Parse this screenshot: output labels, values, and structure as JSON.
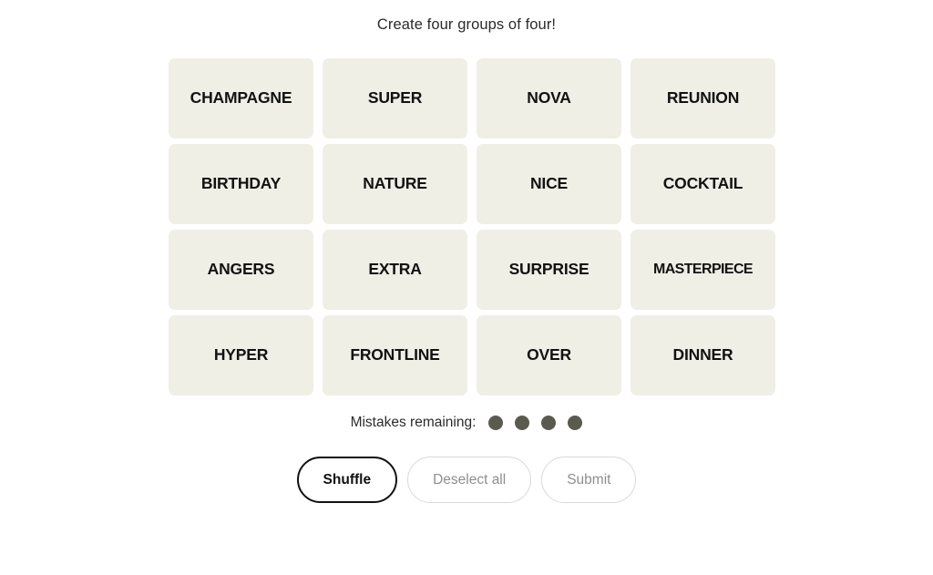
{
  "header": {
    "title": "Create four groups of four!"
  },
  "board": {
    "tiles": [
      {
        "label": "CHAMPAGNE"
      },
      {
        "label": "SUPER"
      },
      {
        "label": "NOVA"
      },
      {
        "label": "REUNION"
      },
      {
        "label": "BIRTHDAY"
      },
      {
        "label": "NATURE"
      },
      {
        "label": "NICE"
      },
      {
        "label": "COCKTAIL"
      },
      {
        "label": "ANGERS"
      },
      {
        "label": "EXTRA"
      },
      {
        "label": "SURPRISE"
      },
      {
        "label": "MASTERPIECE"
      },
      {
        "label": "HYPER"
      },
      {
        "label": "FRONTLINE"
      },
      {
        "label": "OVER"
      },
      {
        "label": "DINNER"
      }
    ],
    "tile_color": "#efefe6",
    "tile_text_color": "#121212"
  },
  "mistakes": {
    "label": "Mistakes remaining:",
    "count": 4,
    "dot_color": "#5a5a4e"
  },
  "controls": {
    "shuffle_label": "Shuffle",
    "deselect_label": "Deselect all",
    "submit_label": "Submit",
    "primary_border_color": "#111111",
    "muted_border_color": "#d9d9d9",
    "muted_text_color": "#8e8e8e"
  }
}
